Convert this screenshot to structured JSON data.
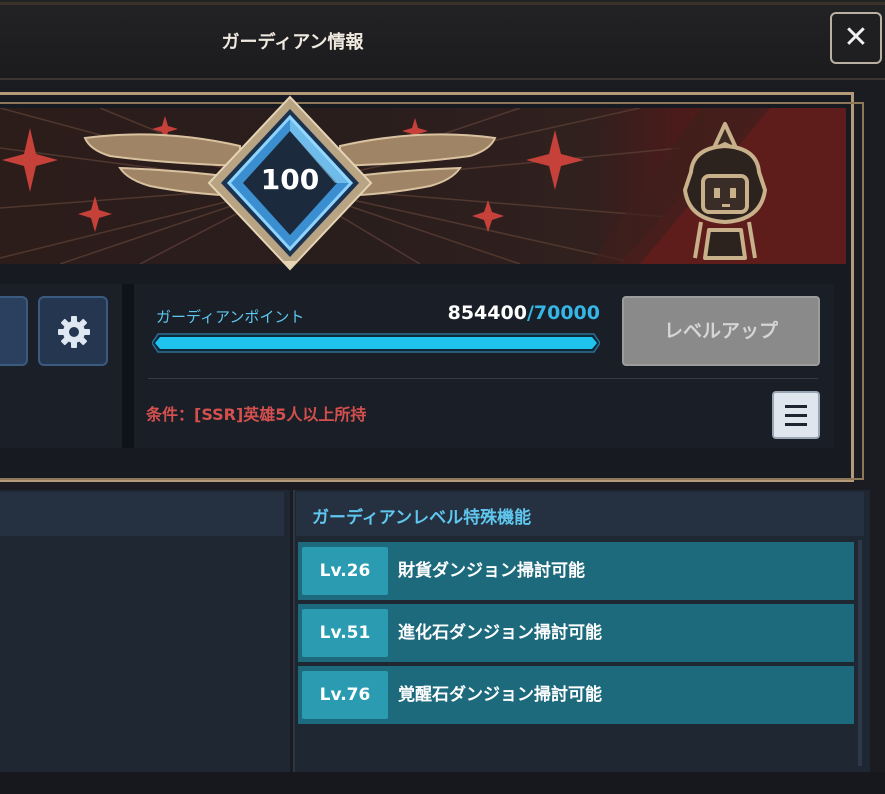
{
  "header": {
    "title": "ガーディアン情報",
    "close_icon": "close-icon"
  },
  "level": {
    "value": "100"
  },
  "guardian_points": {
    "label": "ガーディアンポイント",
    "current": "854400",
    "separator": "/",
    "max": "70000",
    "progress": 1.0
  },
  "actions": {
    "level_up_label": "レベルアップ",
    "settings_icon": "gear-icon",
    "menu_icon": "menu-icon"
  },
  "condition": "条件：[SSR]英雄5人以上所持",
  "special": {
    "title": "ガーディアンレベル特殊機能",
    "features": [
      {
        "level": "Lv.26",
        "text": "財貨ダンジョン掃討可能"
      },
      {
        "level": "Lv.51",
        "text": "進化石ダンジョン掃討可能"
      },
      {
        "level": "Lv.76",
        "text": "覚醒石ダンジョン掃討可能"
      }
    ]
  },
  "colors": {
    "accent_blue": "#35b6e6",
    "gold_frame": "#b49a78",
    "condition_red": "#d4504e",
    "feature_row": "#1d6a7c"
  }
}
